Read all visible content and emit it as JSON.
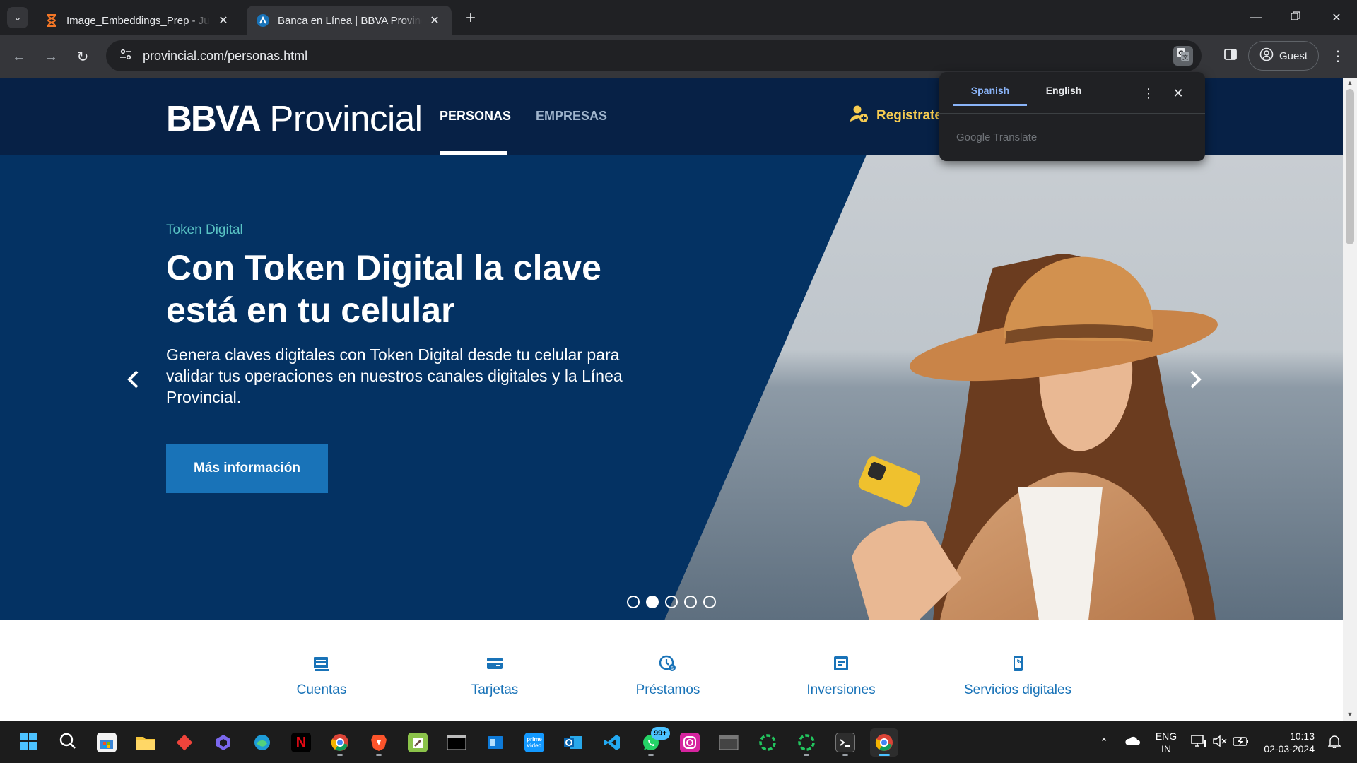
{
  "browser": {
    "tabs": [
      {
        "title": "Image_Embeddings_Prep - Jupyter",
        "favicon": "hourglass-icon",
        "active": false
      },
      {
        "title": "Banca en Línea | BBVA Provincial",
        "favicon": "bbva-favicon",
        "active": true
      }
    ],
    "url": "provincial.com/personas.html",
    "profile_label": "Guest"
  },
  "translate_popup": {
    "source_lang": "Spanish",
    "target_lang": "English",
    "brand": "Google Translate"
  },
  "site": {
    "logo_bold": "BBVA",
    "logo_light": "Provincial",
    "nav": [
      {
        "label": "PERSONAS",
        "active": true
      },
      {
        "label": "EMPRESAS",
        "active": false
      }
    ],
    "register_label": "Regístrate"
  },
  "hero": {
    "eyebrow": "Token Digital",
    "title": "Con Token Digital la clave está en tu celular",
    "text": "Genera claves digitales con Token Digital desde tu celular para validar tus operaciones en nuestros canales digitales y la Línea Provincial.",
    "cta_label": "Más información",
    "slides_total": 5,
    "active_slide": 2
  },
  "products": [
    {
      "label": "Cuentas",
      "icon": "accounts-icon"
    },
    {
      "label": "Tarjetas",
      "icon": "cards-icon"
    },
    {
      "label": "Préstamos",
      "icon": "loans-icon"
    },
    {
      "label": "Inversiones",
      "icon": "investments-icon"
    },
    {
      "label": "Servicios digitales",
      "icon": "digital-services-icon"
    }
  ],
  "taskbar": {
    "whatsapp_badge": "99+",
    "language_line1": "ENG",
    "language_line2": "IN",
    "time": "10:13",
    "date": "02-03-2024"
  },
  "colors": {
    "site_header": "#072146",
    "hero_bg": "#043263",
    "accent_blue": "#1973b8",
    "eyebrow_aqua": "#5ac4c4",
    "register_yellow": "#f8cd51"
  }
}
